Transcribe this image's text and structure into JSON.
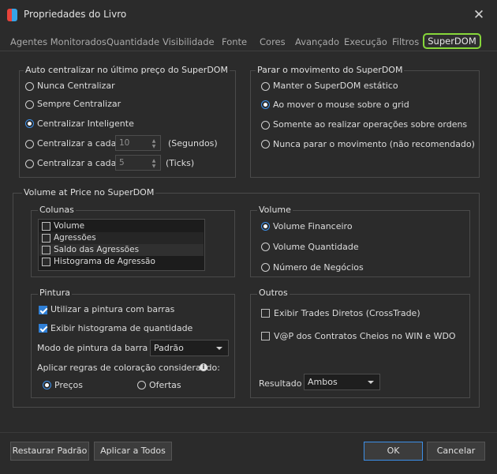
{
  "window": {
    "title": "Propriedades do Livro"
  },
  "tabs": [
    {
      "label": "Agentes Monitorados"
    },
    {
      "label": "Quantidade"
    },
    {
      "label": "Visibilidade"
    },
    {
      "label": "Fonte"
    },
    {
      "label": "Cores"
    },
    {
      "label": "Avançado"
    },
    {
      "label": "Execução"
    },
    {
      "label": "Filtros"
    },
    {
      "label": "SuperDOM",
      "active": true
    }
  ],
  "auto_center": {
    "legend": "Auto centralizar no último preço do SuperDOM",
    "options": [
      {
        "label": "Nunca Centralizar",
        "selected": false
      },
      {
        "label": "Sempre Centralizar",
        "selected": false
      },
      {
        "label": "Centralizar Inteligente",
        "selected": true
      },
      {
        "label": "Centralizar a cada",
        "selected": false,
        "value": "10",
        "unit": "(Segundos)"
      },
      {
        "label": "Centralizar a cada",
        "selected": false,
        "value": "5",
        "unit": "(Ticks)"
      }
    ]
  },
  "stop_movement": {
    "legend": "Parar o movimento do SuperDOM",
    "options": [
      {
        "label": "Manter o SuperDOM estático",
        "selected": false
      },
      {
        "label": "Ao mover o mouse sobre o grid",
        "selected": true
      },
      {
        "label": "Somente ao realizar operações sobre ordens",
        "selected": false
      },
      {
        "label": "Nunca parar o movimento (não recomendado)",
        "selected": false
      }
    ]
  },
  "vap": {
    "legend": "Volume at Price no SuperDOM",
    "columns": {
      "legend": "Colunas",
      "items": [
        {
          "label": "Volume",
          "checked": false
        },
        {
          "label": "Agressões",
          "checked": false
        },
        {
          "label": "Saldo das Agressões",
          "checked": false
        },
        {
          "label": "Histograma de Agressão",
          "checked": false
        }
      ]
    },
    "volume": {
      "legend": "Volume",
      "options": [
        {
          "label": "Volume Financeiro",
          "selected": true
        },
        {
          "label": "Volume Quantidade",
          "selected": false
        },
        {
          "label": "Número de Negócios",
          "selected": false
        }
      ]
    },
    "painting": {
      "legend": "Pintura",
      "use_bars": {
        "label": "Utilizar a pintura com barras",
        "checked": true
      },
      "show_hist": {
        "label": "Exibir histograma de quantidade",
        "checked": true
      },
      "mode_label": "Modo de pintura da barra",
      "mode_value": "Padrão",
      "rules_label": "Aplicar regras de coloração considerando:",
      "rules_options": [
        {
          "label": "Preços",
          "selected": true
        },
        {
          "label": "Ofertas",
          "selected": false
        }
      ]
    },
    "others": {
      "legend": "Outros",
      "items": [
        {
          "label": "Exibir Trades Diretos (CrossTrade)",
          "checked": false
        },
        {
          "label": "V@P dos Contratos Cheios no WIN e WDO",
          "checked": false
        }
      ],
      "result_label": "Resultado",
      "result_value": "Ambos"
    }
  },
  "buttons": {
    "restore": "Restaurar Padrão",
    "apply_all": "Aplicar a Todos",
    "ok": "OK",
    "cancel": "Cancelar"
  },
  "colors": {
    "accent": "#3d8fe8",
    "active_tab_border": "#86d63a",
    "background": "#2b2b2b"
  },
  "icons": [
    "app-logo-icon",
    "close-icon",
    "info-icon",
    "chevron-down-icon"
  ]
}
